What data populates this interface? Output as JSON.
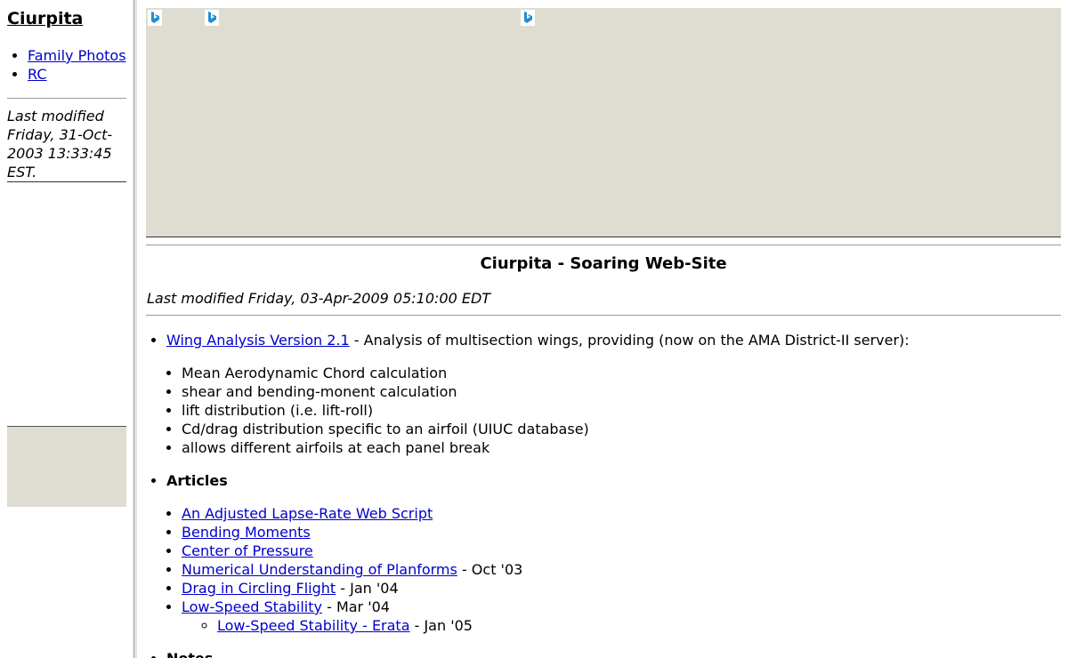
{
  "sidebar": {
    "title": "Ciurpita",
    "nav": [
      {
        "label": "Family Photos"
      },
      {
        "label": "RC"
      }
    ],
    "last_modified": "Last modified Friday, 31-Oct-2003 13:33:45 EST."
  },
  "main": {
    "banner_icons": [
      "bing-icon",
      "bing-icon",
      "bing-icon"
    ],
    "heading": "Ciurpita - Soaring Web-Site",
    "last_modified": "Last modified Friday, 03-Apr-2009 05:10:00 EDT",
    "wing_analysis": {
      "link": "Wing Analysis Version 2.1",
      "desc": " - Analysis of multisection wings, providing (now on the AMA District-II server):",
      "features": [
        "Mean Aerodynamic Chord calculation",
        "shear and bending-monent calculation",
        "lift distribution (i.e. lift-roll)",
        "Cd/drag distribution specific to an airfoil (UIUC database)",
        "allows different airfoils at each panel break"
      ]
    },
    "articles": {
      "label": "Articles",
      "items": [
        {
          "link": "An Adjusted Lapse-Rate Web Script",
          "date": ""
        },
        {
          "link": "Bending Moments",
          "date": ""
        },
        {
          "link": "Center of Pressure",
          "date": ""
        },
        {
          "link": "Numerical Understanding of Planforms",
          "date": " - Oct '03"
        },
        {
          "link": "Drag in Circling Flight",
          "date": " - Jan '04"
        },
        {
          "link": "Low-Speed Stability",
          "date": " - Mar '04"
        }
      ],
      "sub_item": {
        "link": "Low-Speed Stability - Erata",
        "date": " - Jan '05"
      }
    },
    "notes_label": "Notes"
  },
  "colors": {
    "link": "#0000cc",
    "ad_background": "#dfdcd1",
    "bing_icon": "#1e90d6"
  }
}
